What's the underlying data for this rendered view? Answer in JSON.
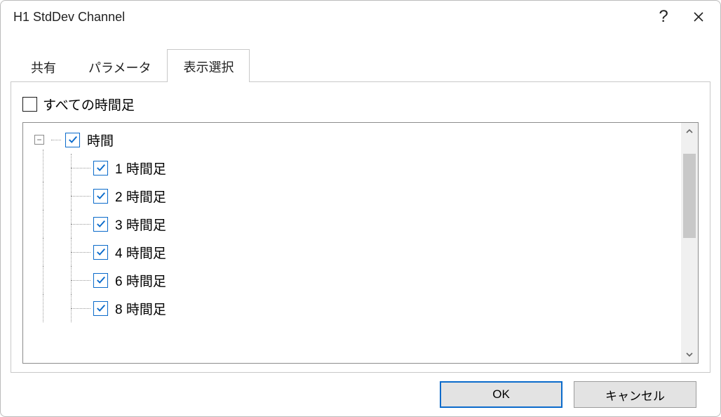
{
  "title": "H1 StdDev Channel",
  "tabs": {
    "t0": "共有",
    "t1": "パラメータ",
    "t2": "表示選択"
  },
  "allTimeframesLabel": "すべての時間足",
  "tree": {
    "rootLabel": "時間",
    "items": {
      "i0": "1 時間足",
      "i1": "2 時間足",
      "i2": "3 時間足",
      "i3": "4 時間足",
      "i4": "6 時間足",
      "i5": "8 時間足"
    }
  },
  "buttons": {
    "ok": "OK",
    "cancel": "キャンセル"
  },
  "expanderGlyph": "−"
}
